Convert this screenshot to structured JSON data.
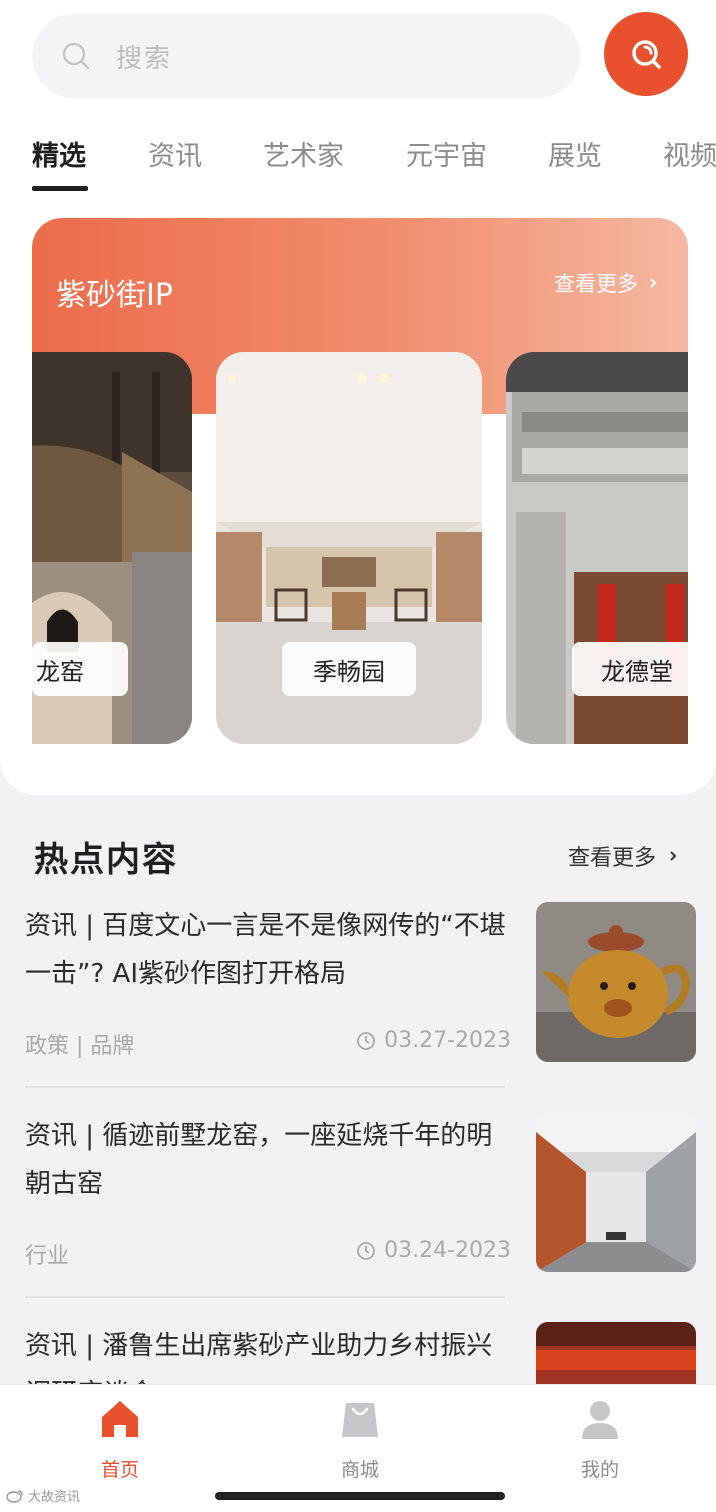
{
  "search": {
    "placeholder": "搜索"
  },
  "tabs": [
    {
      "label": "精选"
    },
    {
      "label": "资讯"
    },
    {
      "label": "艺术家"
    },
    {
      "label": "元宇宙"
    },
    {
      "label": "展览"
    },
    {
      "label": "视频"
    }
  ],
  "ip_section": {
    "title": "紫砂街IP",
    "more": "查看更多",
    "venues": [
      {
        "label": "龙窑"
      },
      {
        "label": "季畅园"
      },
      {
        "label": "龙德堂"
      }
    ]
  },
  "hot_section": {
    "title": "热点内容",
    "more": "查看更多",
    "articles": [
      {
        "title": "资讯 | 百度文心一言是不是像网传的“不堪一击”? AI紫砂作图打开格局",
        "tags": "政策 | 品牌",
        "date": "03.27-2023"
      },
      {
        "title": "资讯 | 循迹前墅龙窑，一座延烧千年的明朝古窑",
        "tags": "行业",
        "date": "03.24-2023"
      },
      {
        "title": "资讯 | 潘鲁生出席紫砂产业助力乡村振兴调研座谈会",
        "tags": "",
        "date": ""
      }
    ]
  },
  "bottom_nav": [
    {
      "label": "首页"
    },
    {
      "label": "商城"
    },
    {
      "label": "我的"
    }
  ],
  "watermark": "大故资讯",
  "colors": {
    "accent": "#e9502e"
  }
}
